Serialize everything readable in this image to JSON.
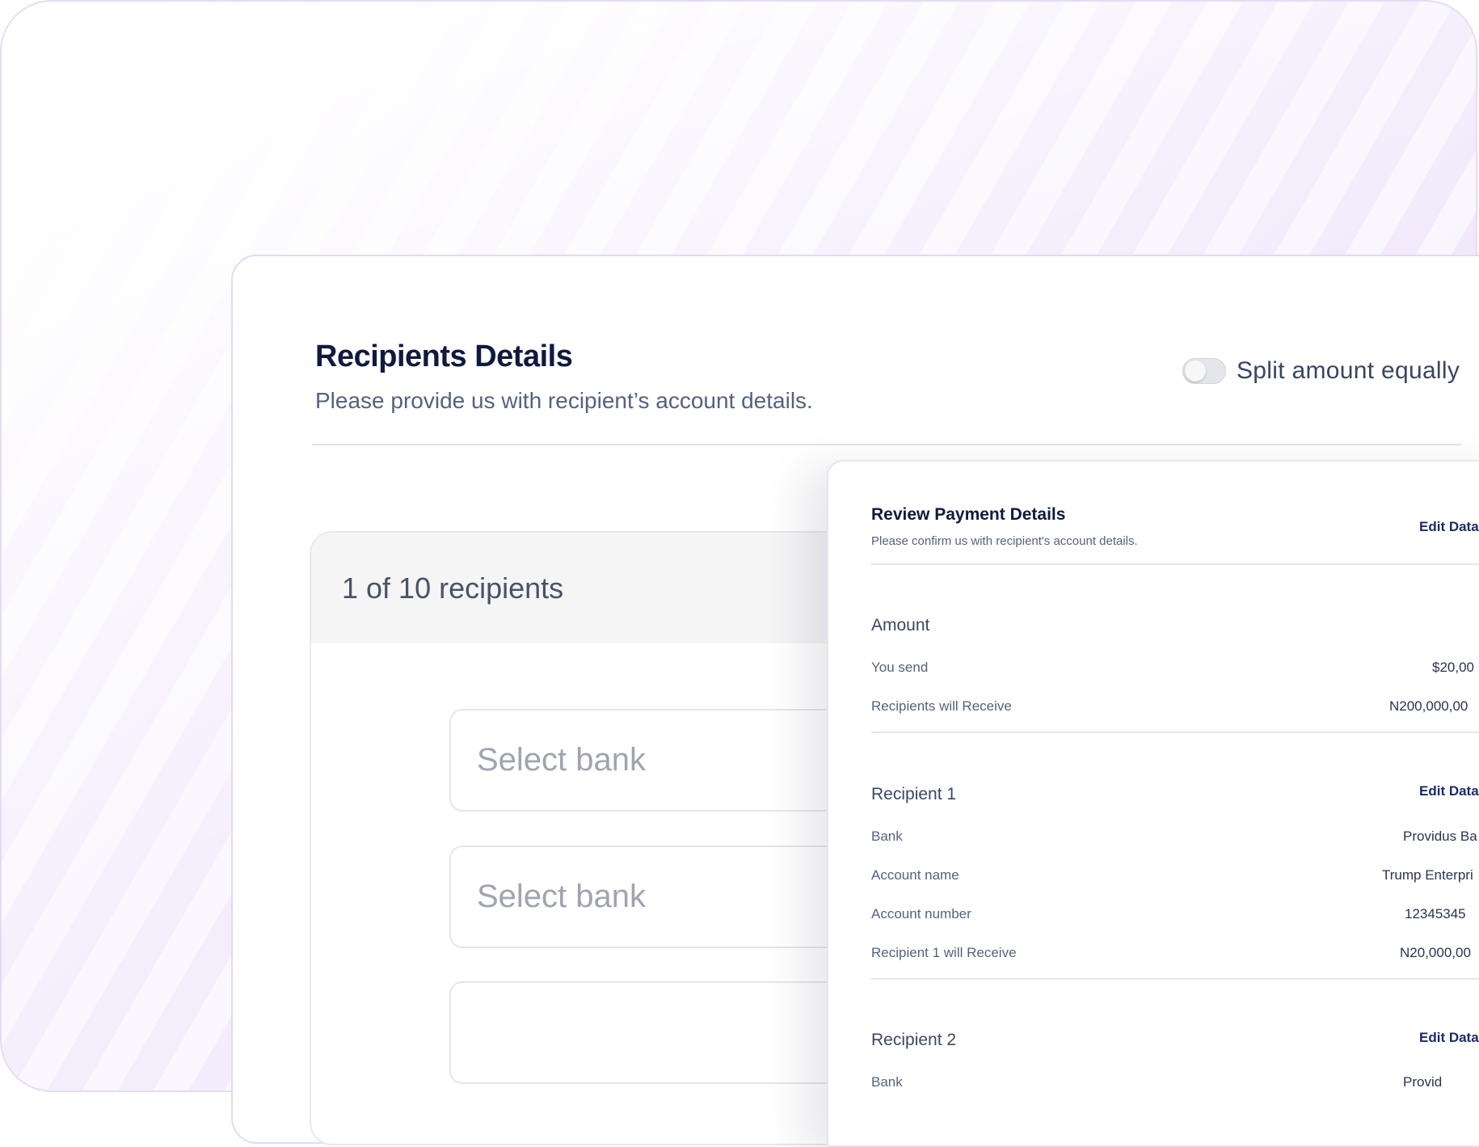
{
  "header": {
    "title": "Recipients Details",
    "subtitle": "Please provide us with recipient’s account details."
  },
  "split_toggle": {
    "label": "Split amount equally",
    "state": "off"
  },
  "recipients_card": {
    "count_label": "1 of 10 recipients",
    "fields": [
      {
        "placeholder": "Select bank"
      },
      {
        "placeholder": "Select bank"
      },
      {
        "placeholder": ""
      }
    ]
  },
  "review": {
    "title": "Review Payment Details",
    "subtitle": "Please confirm us with recipient's account details.",
    "edit_label": "Edit Data",
    "amount": {
      "heading": "Amount",
      "rows": [
        {
          "label": "You send",
          "value": "$20,00"
        },
        {
          "label": "Recipients will Receive",
          "value": "N200,000,00"
        }
      ]
    },
    "recipient1": {
      "heading": "Recipient 1",
      "edit_label": "Edit Data",
      "rows": [
        {
          "label": "Bank",
          "value": "Providus Ba"
        },
        {
          "label": "Account name",
          "value": "Trump Enterpri"
        },
        {
          "label": "Account number",
          "value": "12345345"
        },
        {
          "label": "Recipient 1 will Receive",
          "value": "N20,000,00"
        }
      ]
    },
    "recipient2": {
      "heading": "Recipient 2",
      "edit_label": "Edit Data",
      "rows": [
        {
          "label": "Bank",
          "value": "Provid"
        }
      ]
    }
  }
}
